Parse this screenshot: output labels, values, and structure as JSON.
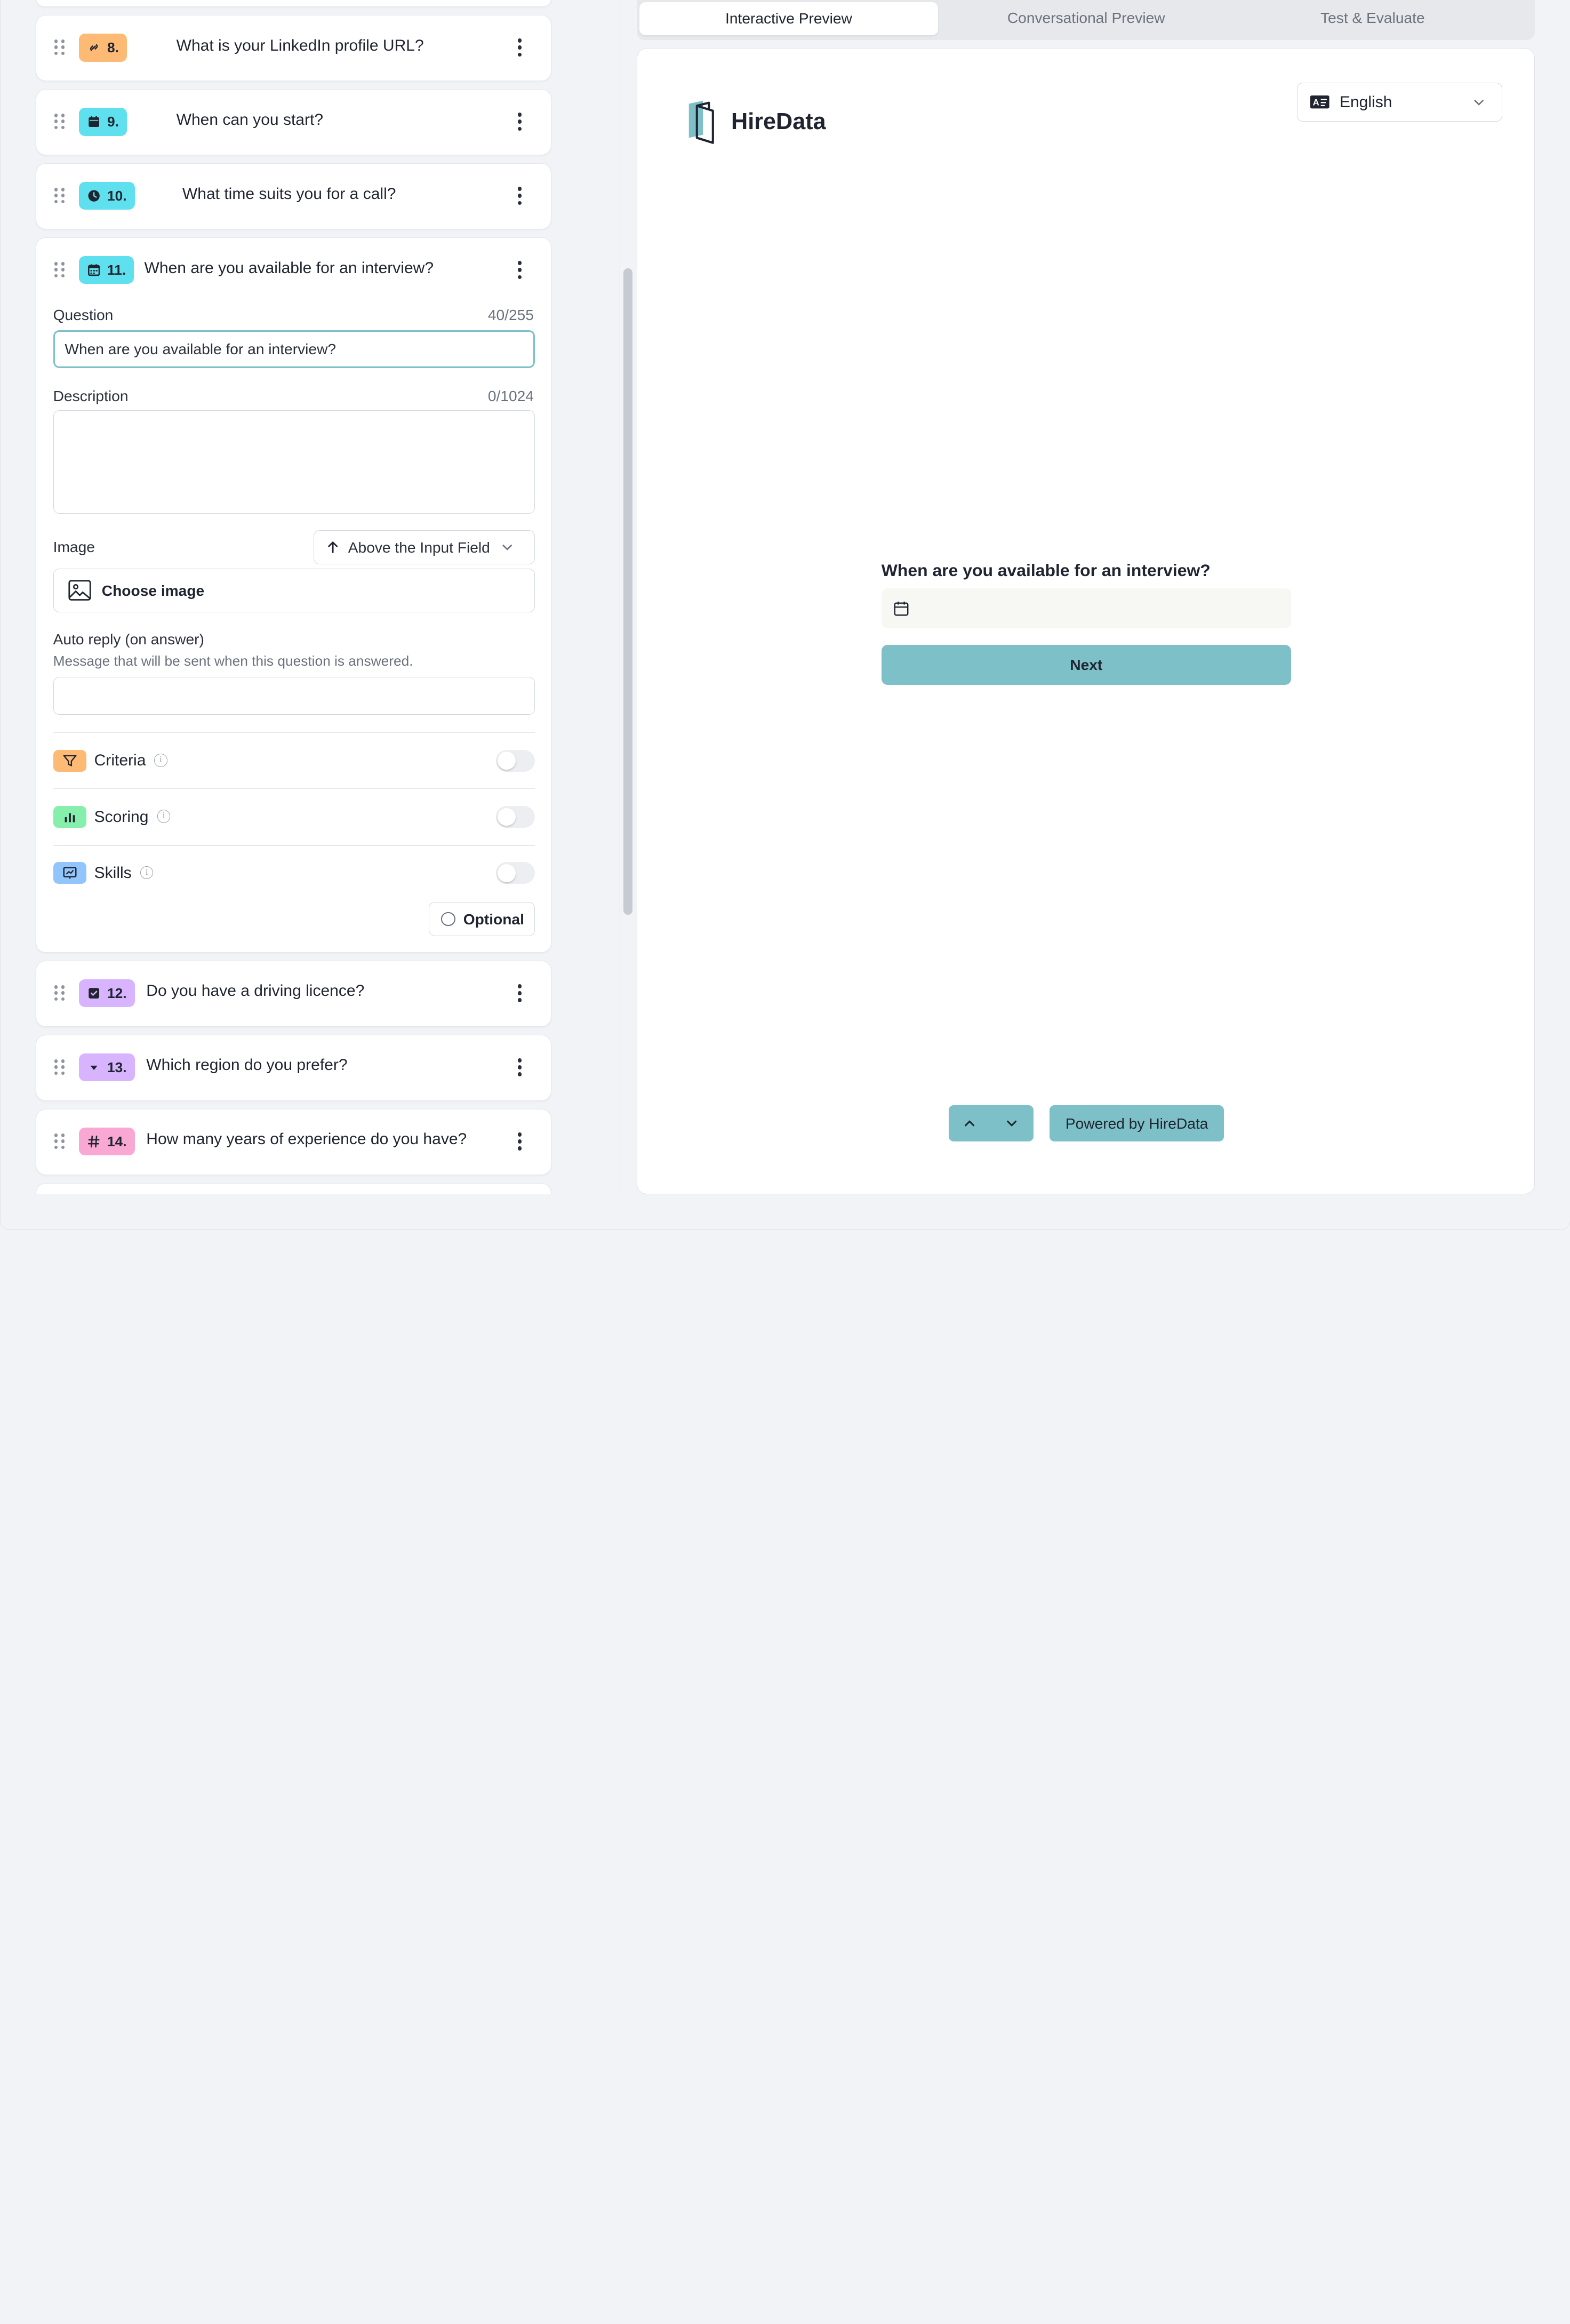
{
  "questions": [
    {
      "number": "8.",
      "title": "What is your LinkedIn profile URL?",
      "icon": "link-icon",
      "color": "#fdba74"
    },
    {
      "number": "9.",
      "title": "When can you start?",
      "icon": "calendar-icon",
      "color": "#5fe0ee"
    },
    {
      "number": "10.",
      "title": "What time suits you for a call?",
      "icon": "clock-icon",
      "color": "#5fe0ee"
    },
    {
      "number": "11.",
      "title": "When are you available for an interview?",
      "icon": "calendar-grid-icon",
      "color": "#5fe0ee"
    },
    {
      "number": "12.",
      "title": "Do you have a driving licence?",
      "icon": "checkbox-icon",
      "color": "#d8b4fe"
    },
    {
      "number": "13.",
      "title": "Which region do you prefer?",
      "icon": "dropdown-icon",
      "color": "#d8b4fe"
    },
    {
      "number": "14.",
      "title": "How many years of experience do you have?",
      "icon": "hash-icon",
      "color": "#f9a8d4"
    }
  ],
  "editor": {
    "question_label": "Question",
    "question_count": "40/255",
    "question_value": "When are you available for an interview?",
    "description_label": "Description",
    "description_count": "0/1024",
    "description_value": "",
    "image_label": "Image",
    "image_position": "Above the Input Field",
    "choose_image": "Choose image",
    "auto_reply_label": "Auto reply (on answer)",
    "auto_reply_hint": "Message that will be sent when this question is answered.",
    "auto_reply_value": "",
    "criteria": "Criteria",
    "scoring": "Scoring",
    "skills": "Skills",
    "optional": "Optional"
  },
  "tabs": [
    "Interactive Preview",
    "Conversational Preview",
    "Test & Evaluate"
  ],
  "preview": {
    "brand": "HireData",
    "language": "English",
    "question": "When are you available for an interview?",
    "next": "Next",
    "powered_by": "Powered by HireData"
  },
  "colors": {
    "accent": "#7ec0c7",
    "criteria_badge": "#fdba74",
    "scoring_badge": "#86efac",
    "skills_badge": "#93c5fd"
  }
}
